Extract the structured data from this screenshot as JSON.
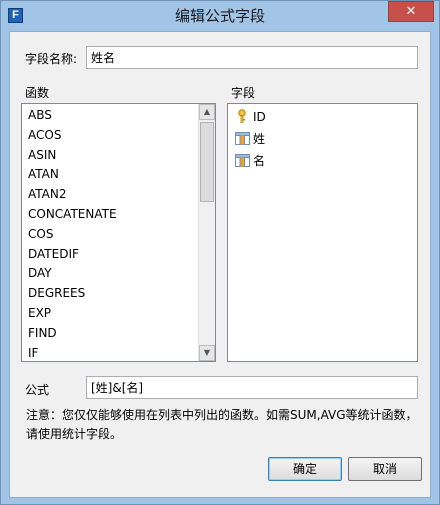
{
  "window": {
    "title": "编辑公式字段",
    "close_glyph": "✕",
    "app_icon_letter": "F"
  },
  "field_name": {
    "label": "字段名称:",
    "value": "姓名"
  },
  "functions": {
    "label": "函数",
    "items": [
      "ABS",
      "ACOS",
      "ASIN",
      "ATAN",
      "ATAN2",
      "CONCATENATE",
      "COS",
      "DATEDIF",
      "DAY",
      "DEGREES",
      "EXP",
      "FIND",
      "IF"
    ]
  },
  "fields": {
    "label": "字段",
    "items": [
      {
        "name": "ID",
        "icon": "key-icon"
      },
      {
        "name": "姓",
        "icon": "table-column-icon"
      },
      {
        "name": "名",
        "icon": "table-column-icon"
      }
    ]
  },
  "formula": {
    "label": "公式",
    "value": "[姓]&[名]"
  },
  "note": "注意：您仅仅能够使用在列表中列出的函数。如需SUM,AVG等统计函数，请使用统计字段。",
  "buttons": {
    "ok": "确定",
    "cancel": "取消"
  },
  "colors": {
    "titlebar": "#a2c4e6",
    "close": "#c7504b",
    "dialog_bg": "#f0f0f0"
  }
}
